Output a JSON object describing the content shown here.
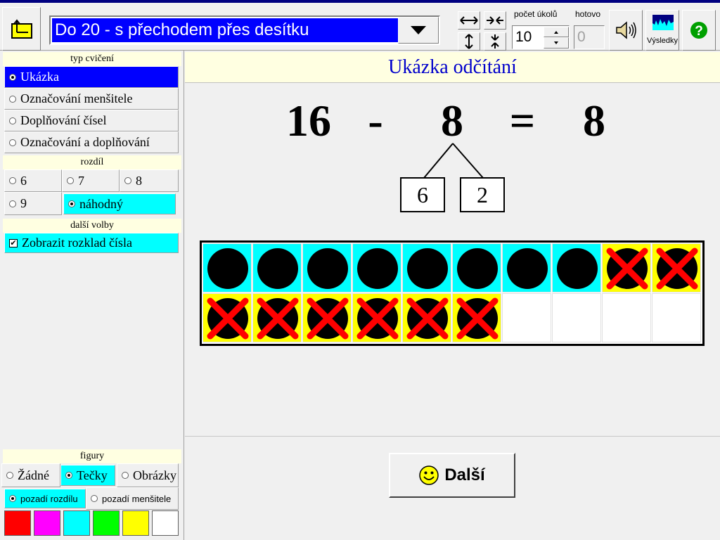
{
  "toolbar": {
    "exercise_title": "Do 20 - s přechodem přes desítku",
    "count_label": "počet úkolů",
    "count_value": "10",
    "done_label": "hotovo",
    "done_value": "0",
    "results_label": "Výsledky",
    "icons": [
      "folder-up-icon",
      "chevron-down-icon",
      "expand-horizontal-icon",
      "shrink-horizontal-icon",
      "expand-vertical-icon",
      "shrink-vertical-icon",
      "speaker-icon",
      "results-icon",
      "help-icon"
    ]
  },
  "sidebar": {
    "type_header": "typ cvičení",
    "types": [
      "Ukázka",
      "Označování menšitele",
      "Doplňování čísel",
      "Označování a doplňování"
    ],
    "selected_type": 0,
    "diff_header": "rozdíl",
    "diffs": [
      "6",
      "7",
      "8",
      "9",
      "náhodný"
    ],
    "selected_diff": 4,
    "more_header": "další volby",
    "show_decomposition": "Zobrazit rozklad čísla",
    "figures_header": "figury",
    "figures": [
      "Žádné",
      "Tečky",
      "Obrázky"
    ],
    "selected_figure": 1,
    "bg_options": [
      "pozadí rozdílu",
      "pozadí menšitele"
    ],
    "selected_bg": 0,
    "colors": [
      "#ff0000",
      "#ff00ff",
      "#00ffff",
      "#00ff00",
      "#ffff00",
      "#ffffff"
    ]
  },
  "main": {
    "title": "Ukázka odčítání",
    "equation": {
      "minuend": "16",
      "op": "-",
      "subtrahend": "8",
      "eq": "=",
      "result": "8"
    },
    "decomposition": [
      "6",
      "2"
    ],
    "grid": {
      "row1": [
        "dot-cyan",
        "dot-cyan",
        "dot-cyan",
        "dot-cyan",
        "dot-cyan",
        "dot-cyan",
        "dot-cyan",
        "dot-cyan",
        "cross-yellow",
        "cross-yellow"
      ],
      "row2": [
        "cross-yellow",
        "cross-yellow",
        "cross-yellow",
        "cross-yellow",
        "cross-yellow",
        "cross-yellow",
        "empty",
        "empty",
        "empty",
        "empty"
      ]
    },
    "next_label": "Další",
    "colors": {
      "cyan": "#00ffff",
      "yellow": "#ffff00",
      "cross": "#ff0000",
      "title": "#0000cc"
    }
  }
}
